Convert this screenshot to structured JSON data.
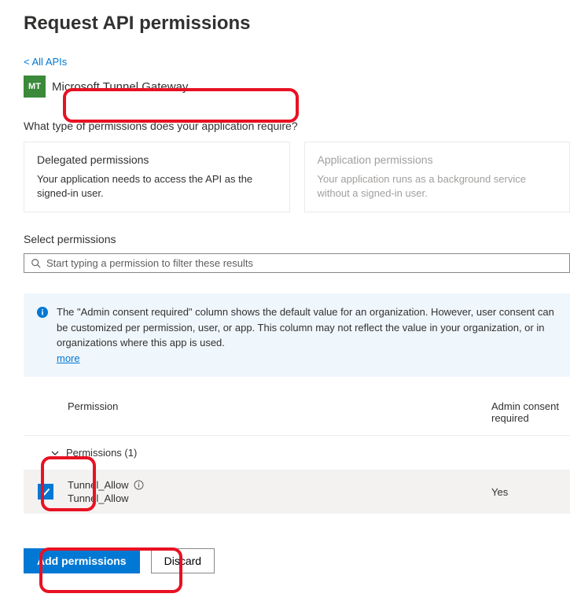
{
  "page": {
    "title": "Request API permissions"
  },
  "back": {
    "label": "< All APIs"
  },
  "api": {
    "iconText": "MT",
    "name": "Microsoft Tunnel Gateway"
  },
  "permissionQuestion": "What type of permissions does your application require?",
  "cards": {
    "delegated": {
      "title": "Delegated permissions",
      "desc": "Your application needs to access the API as the signed-in user."
    },
    "application": {
      "title": "Application permissions",
      "desc": "Your application runs as a background service without a signed-in user."
    }
  },
  "selectPermissionsLabel": "Select permissions",
  "search": {
    "placeholder": "Start typing a permission to filter these results"
  },
  "infoBanner": {
    "text": "The \"Admin consent required\" column shows the default value for an organization. However, user consent can be customized per permission, user, or app. This column may not reflect the value in your organization, or in organizations where this app is used.",
    "more": "more"
  },
  "tableHeaders": {
    "permission": "Permission",
    "consent": "Admin consent required"
  },
  "group": {
    "label": "Permissions (1)"
  },
  "permRow": {
    "nameTop": "Tunnel_Allow",
    "nameBottom": "Tunnel_Allow",
    "consent": "Yes"
  },
  "buttons": {
    "add": "Add permissions",
    "discard": "Discard"
  }
}
